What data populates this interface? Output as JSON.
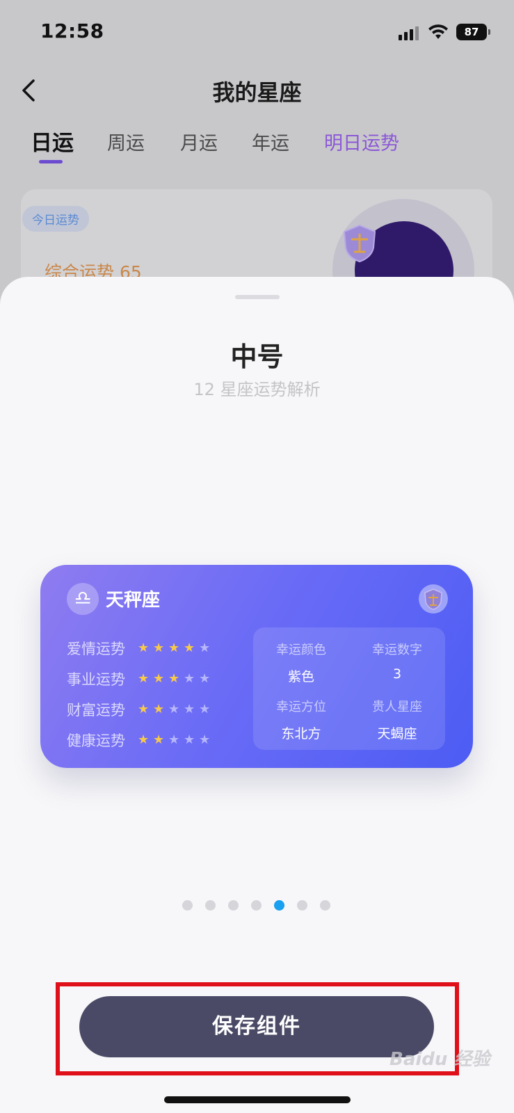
{
  "status_bar": {
    "time": "12:58",
    "battery": "87"
  },
  "nav": {
    "title": "我的星座"
  },
  "tabs": [
    {
      "label": "日运"
    },
    {
      "label": "周运"
    },
    {
      "label": "月运"
    },
    {
      "label": "年运"
    },
    {
      "label": "明日运势"
    }
  ],
  "background_card": {
    "badge": "今日运势",
    "score_text": "综合运势 65"
  },
  "sheet": {
    "title": "中号",
    "subtitle": "12 星座运势解析"
  },
  "widget": {
    "sign_symbol": "♎",
    "sign_name": "天秤座",
    "fortunes": [
      {
        "label": "爱情运势",
        "stars": 4
      },
      {
        "label": "事业运势",
        "stars": 3
      },
      {
        "label": "财富运势",
        "stars": 2
      },
      {
        "label": "健康运势",
        "stars": 2
      }
    ],
    "lucky": [
      {
        "key": "幸运颜色",
        "value": "紫色"
      },
      {
        "key": "幸运数字",
        "value": "3"
      },
      {
        "key": "幸运方位",
        "value": "东北方"
      },
      {
        "key": "贵人星座",
        "value": "天蝎座"
      }
    ]
  },
  "pager": {
    "count": 7,
    "active_index": 4
  },
  "save_button": {
    "label": "保存组件"
  },
  "watermark": {
    "text": "Baidu 经验"
  },
  "colors": {
    "accent_purple": "#6d4bd0",
    "tomorrow_tab": "#8b57d6",
    "save_button_bg": "#4a4a66",
    "pager_active": "#1aa0f0",
    "highlight_border": "#e0101a",
    "star_on": "#f7c94a"
  }
}
